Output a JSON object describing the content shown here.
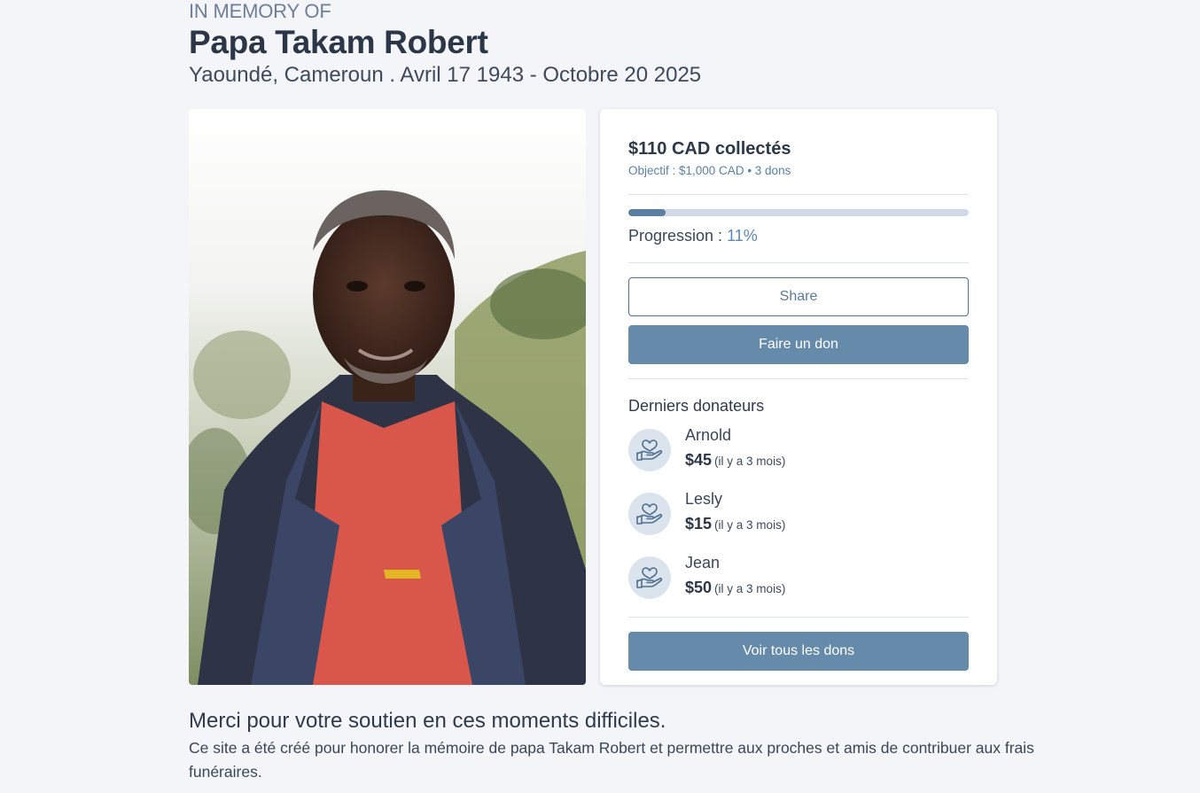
{
  "header": {
    "kicker": "IN MEMORY OF",
    "name": "Papa Takam Robert",
    "details": "Yaoundé, Cameroun . Avril 17 1943 - Octobre 20 2025"
  },
  "fundraiser": {
    "raised": "$110 CAD collectés",
    "goal_line": "Objectif : $1,000 CAD • 3 dons",
    "progress_fraction": 0.11,
    "progress_label": "Progression : ",
    "progress_value": "11%",
    "share_label": "Share",
    "donate_label": "Faire un don",
    "view_all_label": "Voir tous les dons"
  },
  "donors": {
    "title": "Derniers donateurs",
    "items": [
      {
        "name": "Arnold",
        "amount": "$45",
        "when": "(il y a 3 mois)"
      },
      {
        "name": "Lesly",
        "amount": "$15",
        "when": "(il y a 3 mois)"
      },
      {
        "name": "Jean",
        "amount": "$50",
        "when": "(il y a 3 mois)"
      }
    ]
  },
  "message": {
    "title": "Merci pour votre soutien en ces moments difficiles.",
    "body": "Ce site a été créé pour honorer la mémoire de papa Takam Robert et permettre aux proches et amis de contribuer aux frais funéraires."
  },
  "colors": {
    "accent": "#668baa",
    "progress_fill": "#5b7fa3",
    "progress_track": "#cfdae6",
    "background": "#f4f5f9"
  },
  "icons": {
    "donor_avatar": "hand-heart-icon"
  }
}
